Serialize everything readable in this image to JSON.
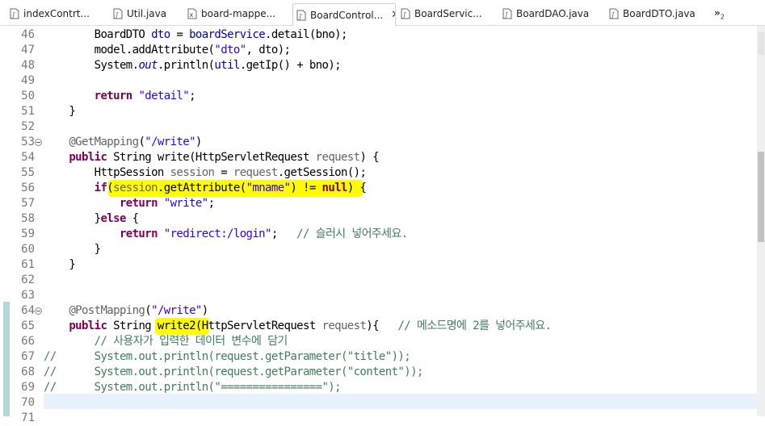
{
  "tabs": [
    {
      "label": "indexContrt...",
      "icon": "java-file-icon",
      "active": false
    },
    {
      "label": "Util.java",
      "icon": "java-file-icon",
      "active": false
    },
    {
      "label": "board-mappe...",
      "icon": "xml-file-icon",
      "active": false
    },
    {
      "label": "BoardControl...",
      "icon": "java-file-icon",
      "active": true
    },
    {
      "label": "BoardServic...",
      "icon": "java-file-icon",
      "active": false
    },
    {
      "label": "BoardDAO.java",
      "icon": "java-file-icon",
      "active": false
    },
    {
      "label": "BoardDTO.java",
      "icon": "java-file-icon",
      "active": false
    }
  ],
  "tab_overflow": {
    "symbol": "»",
    "count": "2"
  },
  "colors": {
    "keyword": "#7f0055",
    "string": "#2a00ff",
    "field": "#0000c0",
    "annotation": "#646464",
    "comment": "#3f7f5f",
    "highlight": "#fffb00",
    "current_line": "#e8f2fe"
  },
  "editor": {
    "lines": [
      {
        "num": "46",
        "tokens": [
          [
            "p",
            "        BoardDTO "
          ],
          [
            "f",
            "dto"
          ],
          [
            "p",
            " = "
          ],
          [
            "f",
            "boardService"
          ],
          [
            "p",
            ".detail(bno);"
          ]
        ]
      },
      {
        "num": "47",
        "tokens": [
          [
            "p",
            "        model.addAttribute("
          ],
          [
            "s",
            "\"dto\""
          ],
          [
            "p",
            ", dto);"
          ]
        ]
      },
      {
        "num": "48",
        "tokens": [
          [
            "p",
            "        System."
          ],
          [
            "fi",
            "out"
          ],
          [
            "p",
            ".println("
          ],
          [
            "f",
            "util"
          ],
          [
            "p",
            ".getIp() + bno);"
          ]
        ]
      },
      {
        "num": "49",
        "tokens": []
      },
      {
        "num": "50",
        "tokens": [
          [
            "k",
            "        return "
          ],
          [
            "s",
            "\"detail\""
          ],
          [
            "p",
            ";"
          ]
        ]
      },
      {
        "num": "51",
        "tokens": [
          [
            "p",
            "    }"
          ]
        ]
      },
      {
        "num": "52",
        "tokens": []
      },
      {
        "num": "53",
        "fold": true,
        "tokens": [
          [
            "a",
            "    @GetMapping"
          ],
          [
            "p",
            "("
          ],
          [
            "s",
            "\"/write\""
          ],
          [
            "p",
            ")"
          ]
        ]
      },
      {
        "num": "54",
        "tokens": [
          [
            "k",
            "    public "
          ],
          [
            "p",
            "String write(HttpServletRequest "
          ],
          [
            "a",
            "request"
          ],
          [
            "p",
            ") {"
          ]
        ]
      },
      {
        "num": "55",
        "tokens": [
          [
            "p",
            "        HttpSession "
          ],
          [
            "a",
            "session"
          ],
          [
            "p",
            " = "
          ],
          [
            "a",
            "request"
          ],
          [
            "p",
            ".getSession();"
          ]
        ]
      },
      {
        "num": "56",
        "tokens": [
          [
            "k",
            "        if"
          ],
          [
            "p",
            "("
          ],
          [
            "a",
            "session"
          ],
          [
            "p",
            ".getAttribute("
          ],
          [
            "s",
            "\"mname\""
          ],
          [
            "p",
            ") != "
          ],
          [
            "k",
            "null"
          ],
          [
            "p",
            ") {"
          ]
        ]
      },
      {
        "num": "57",
        "tokens": [
          [
            "k",
            "            return "
          ],
          [
            "s",
            "\"write\""
          ],
          [
            "p",
            ";"
          ]
        ]
      },
      {
        "num": "58",
        "tokens": [
          [
            "p",
            "        }"
          ],
          [
            "k",
            "else"
          ],
          [
            "p",
            " {"
          ]
        ]
      },
      {
        "num": "59",
        "tokens": [
          [
            "k",
            "            return "
          ],
          [
            "s",
            "\"redirect:/login\""
          ],
          [
            "p",
            ";   "
          ],
          [
            "c",
            "// 슬러시 넣어주세요."
          ]
        ]
      },
      {
        "num": "60",
        "tokens": [
          [
            "p",
            "        }"
          ]
        ]
      },
      {
        "num": "61",
        "tokens": [
          [
            "p",
            "    }"
          ]
        ]
      },
      {
        "num": "62",
        "tokens": []
      },
      {
        "num": "63",
        "tokens": []
      },
      {
        "num": "64",
        "fold": true,
        "tokens": [
          [
            "a",
            "    @PostMapping"
          ],
          [
            "p",
            "("
          ],
          [
            "s",
            "\"/write\""
          ],
          [
            "p",
            ")"
          ]
        ]
      },
      {
        "num": "65",
        "tokens": [
          [
            "k",
            "    public "
          ],
          [
            "p",
            "String write2(HttpServletRequest "
          ],
          [
            "a",
            "request"
          ],
          [
            "p",
            "){   "
          ],
          [
            "c",
            "// 메소드명에 2를 넣어주세요."
          ]
        ]
      },
      {
        "num": "66",
        "tokens": [
          [
            "c",
            "        // 사용자가 입력한 데이터 변수에 담기"
          ]
        ]
      },
      {
        "num": "67",
        "tokens": [
          [
            "c",
            "//      System.out.println(request.getParameter(\"title\"));"
          ]
        ]
      },
      {
        "num": "68",
        "tokens": [
          [
            "c",
            "//      System.out.println(request.getParameter(\"content\"));"
          ]
        ]
      },
      {
        "num": "69",
        "tokens": [
          [
            "c",
            "//      System.out.println(\"================\");"
          ]
        ]
      },
      {
        "num": "70",
        "tokens": []
      },
      {
        "num": "71",
        "tokens": []
      }
    ]
  }
}
